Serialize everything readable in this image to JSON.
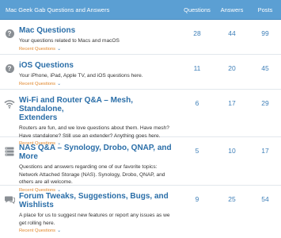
{
  "header": {
    "title": "Mac Geek Gab Questions and Answers",
    "col_questions": "Questions",
    "col_answers": "Answers",
    "col_posts": "Posts"
  },
  "forums": [
    {
      "icon": "question-circle-icon",
      "title": "Mac Questions",
      "desc": "Your questions related to Macs and macOS",
      "recent": "Recent Questions",
      "questions": "28",
      "answers": "44",
      "posts": "99"
    },
    {
      "icon": "question-circle-icon",
      "title": "iOS Questions",
      "desc": "Your iPhone, iPad, Apple TV, and iOS questions here.",
      "recent": "Recent Questions",
      "questions": "11",
      "answers": "20",
      "posts": "45"
    },
    {
      "icon": "wifi-icon",
      "title_1": "Wi-Fi and Router Q&A – Mesh, Standalone,",
      "title_2": "Extenders",
      "desc_1": "Routers are fun, and we love questions about them. Have mesh?",
      "desc_2": "Have standalone? Still use an extender? Anything goes here.",
      "recent": "Recent Questions",
      "questions": "6",
      "answers": "17",
      "posts": "29"
    },
    {
      "icon": "server-icon",
      "title": "NAS Q&A – Synology, Drobo, QNAP, and More",
      "desc_1": "Questions and answers regarding one of our favorite topics:",
      "desc_2": "Network Attached Storage (NAS). Synology, Drobo, QNAP, and",
      "desc_3": "others are all welcome.",
      "recent": "Recent Questions",
      "questions": "5",
      "answers": "10",
      "posts": "17"
    },
    {
      "icon": "chat-bubble-icon",
      "title": "Forum Tweaks, Suggestions, Bugs, and Wishlists",
      "desc_1": "A place for us to suggest new features or report any issues as we",
      "desc_2": "get rolling here.",
      "recent": "Recent Questions",
      "questions": "9",
      "answers": "25",
      "posts": "54"
    }
  ]
}
